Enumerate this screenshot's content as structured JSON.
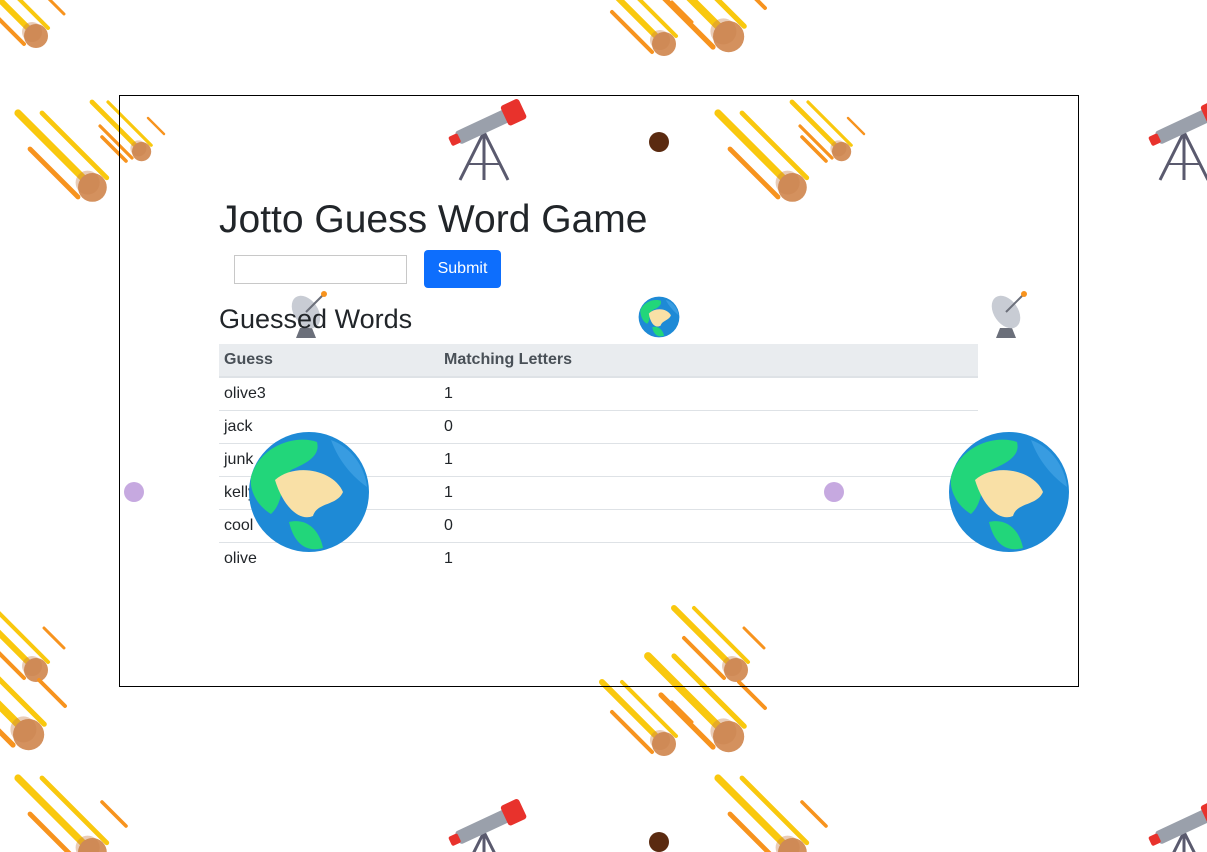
{
  "page": {
    "title": "Jotto Guess Word Game"
  },
  "form": {
    "input_value": "",
    "input_placeholder": "",
    "submit_label": "Submit"
  },
  "guessed": {
    "heading": "Guessed Words",
    "columns": [
      "Guess",
      "Matching Letters"
    ],
    "rows": [
      {
        "guess": "olive3",
        "matching": "1"
      },
      {
        "guess": "jack",
        "matching": "0"
      },
      {
        "guess": "junk",
        "matching": "1"
      },
      {
        "guess": "kelly",
        "matching": "1"
      },
      {
        "guess": "cool",
        "matching": "0"
      },
      {
        "guess": "olive",
        "matching": "1"
      }
    ]
  },
  "decorations": {
    "icons": [
      "meteor-icon",
      "telescope-icon",
      "planet-dot-icon",
      "satellite-dish-icon",
      "earth-globe-icon"
    ],
    "colors": {
      "accent": "#0d6efd",
      "meteor_yellow": "#f9c80e",
      "meteor_orange": "#f7931e",
      "meteor_rock": "#d4915e",
      "earth_blue": "#1e8ad6",
      "earth_green": "#22d67a",
      "earth_sand": "#f9e0a6",
      "dot_brown": "#5a2a10",
      "dot_lavender": "#c6a9e0"
    }
  }
}
